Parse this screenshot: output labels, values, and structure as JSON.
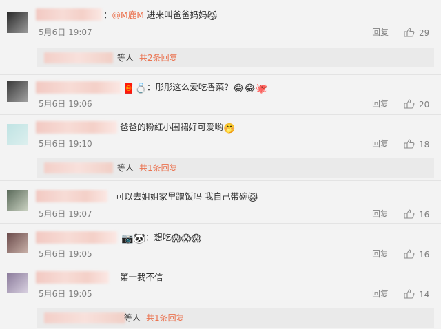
{
  "comments": [
    {
      "mention": "@M鹿M",
      "text": " 进来叫爸爸妈妈",
      "emoji": "😼",
      "date": "5月6日 19:07",
      "reply": "回复",
      "likes": "29",
      "sub": {
        "who": "等人",
        "count": "共2条回复"
      }
    },
    {
      "prefix_icons": [
        "🧧",
        "💍"
      ],
      "text": "：彤彤这么爱吃香菜？",
      "emoji": "😂😂🐙",
      "date": "5月6日 19:06",
      "reply": "回复",
      "likes": "20"
    },
    {
      "text": "爸爸的粉红小围裙好可爱哟",
      "emoji": "🤭",
      "date": "5月6日 19:10",
      "reply": "回复",
      "likes": "18",
      "sub": {
        "who": "等人",
        "count": "共1条回复"
      }
    },
    {
      "text": "可以去姐姐家里蹭饭吗 我自己带碗",
      "emoji": "😺",
      "date": "5月6日 19:07",
      "reply": "回复",
      "likes": "16"
    },
    {
      "prefix_icons": [
        "📷",
        "🐼"
      ],
      "text": "：想吃",
      "emoji": "😱😱😱",
      "date": "5月6日 19:05",
      "reply": "回复",
      "likes": "16"
    },
    {
      "text": "第一我不信",
      "emoji": "",
      "date": "5月6日 19:05",
      "reply": "回复",
      "likes": "14",
      "sub": {
        "who": "等人",
        "count": "共1条回复"
      }
    }
  ],
  "colors": {
    "accent": "#eb7350",
    "muted": "#808080",
    "background": "#f3f3f3"
  }
}
